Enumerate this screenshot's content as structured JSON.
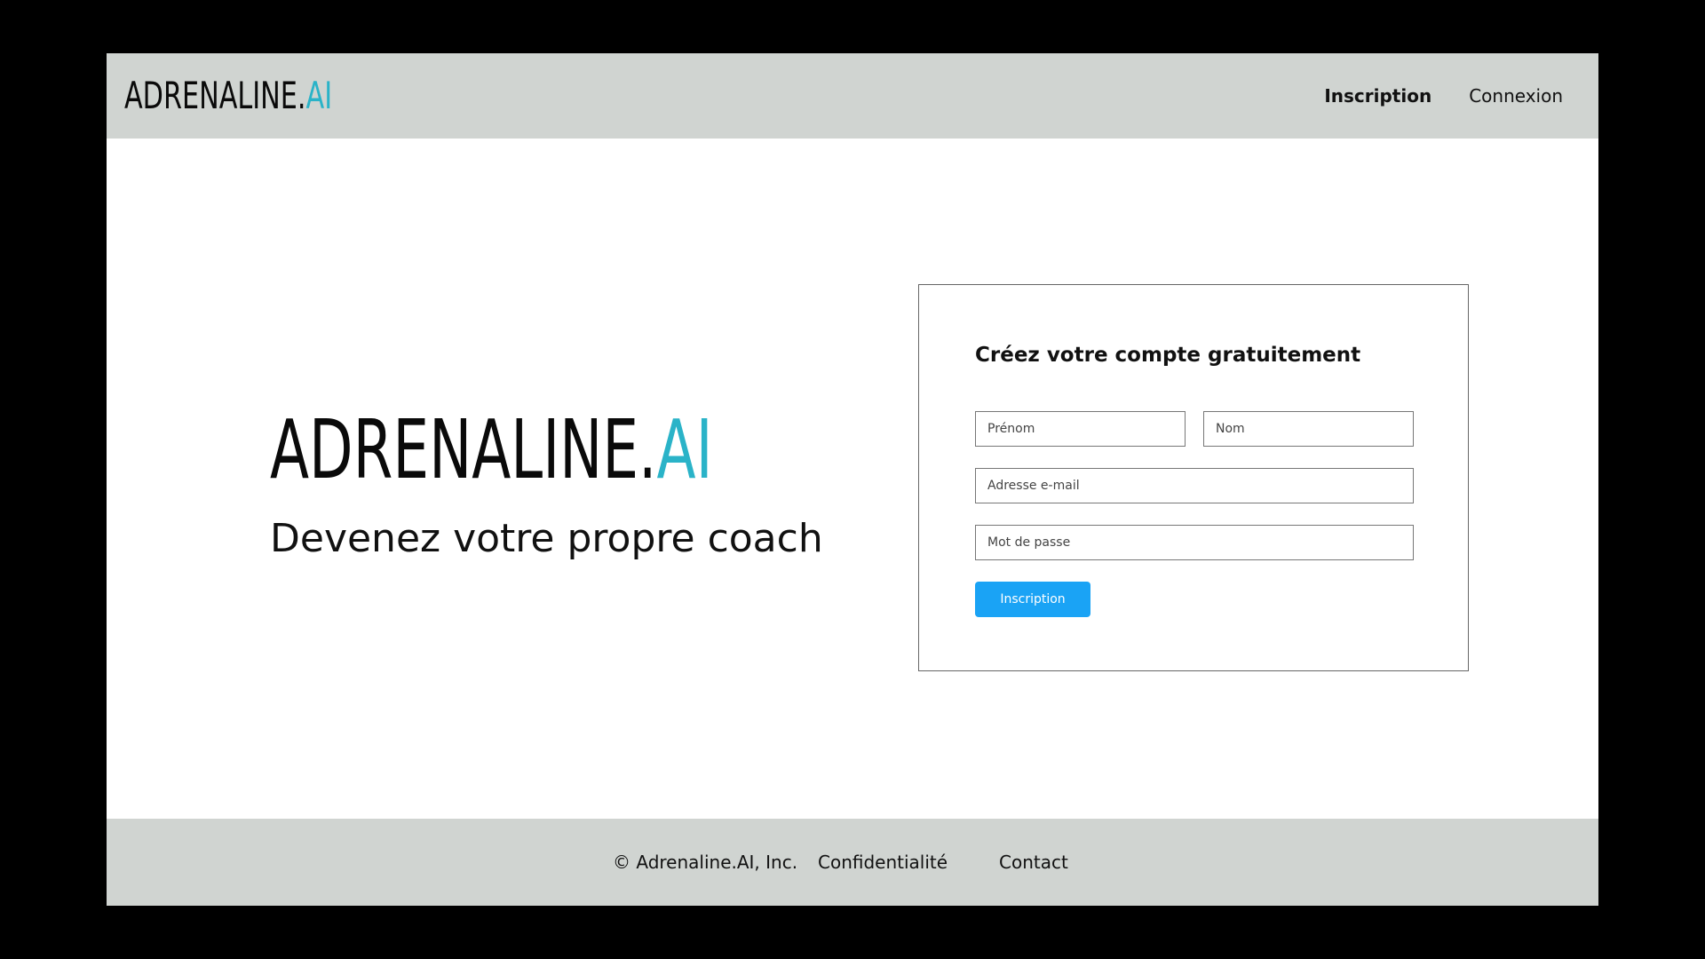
{
  "brand": {
    "name_main": "ADRENALINE.",
    "name_accent": "AI",
    "accent_color": "#2ab3c8"
  },
  "header": {
    "nav": [
      {
        "label": "Inscription",
        "active": true
      },
      {
        "label": "Connexion",
        "active": false
      }
    ]
  },
  "hero": {
    "tagline": "Devenez votre propre coach"
  },
  "signup_form": {
    "title": "Créez votre compte gratuitement",
    "firstname_placeholder": "Prénom",
    "lastname_placeholder": "Nom",
    "email_placeholder": "Adresse e-mail",
    "password_placeholder": "Mot de passe",
    "submit_label": "Inscription",
    "submit_color": "#1aa3f5"
  },
  "footer": {
    "copyright": "© Adrenaline.AI, Inc.",
    "privacy": "Confidentialité",
    "contact": "Contact"
  }
}
